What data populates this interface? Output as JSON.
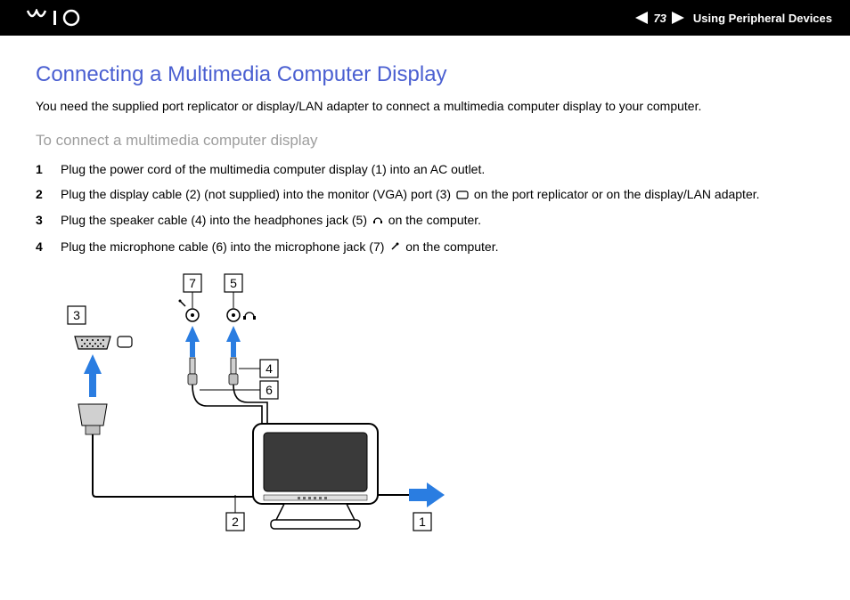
{
  "header": {
    "page_number": "73",
    "section": "Using Peripheral Devices"
  },
  "content": {
    "heading": "Connecting a Multimedia Computer Display",
    "intro": "You need the supplied port replicator or display/LAN adapter to connect a multimedia computer display to your computer.",
    "subheading": "To connect a multimedia computer display",
    "steps": [
      "Plug the power cord of the multimedia computer display (1) into an AC outlet.",
      "Plug the display cable (2) (not supplied) into the monitor (VGA) port (3) ▢ on the port replicator or on the display/LAN adapter.",
      "Plug the speaker cable (4) into the headphones jack (5) ♫ on the computer.",
      "Plug the microphone cable (6) into the microphone jack (7) 🎤 on the computer."
    ]
  },
  "diagram": {
    "labels": [
      "1",
      "2",
      "3",
      "4",
      "5",
      "6",
      "7"
    ]
  }
}
